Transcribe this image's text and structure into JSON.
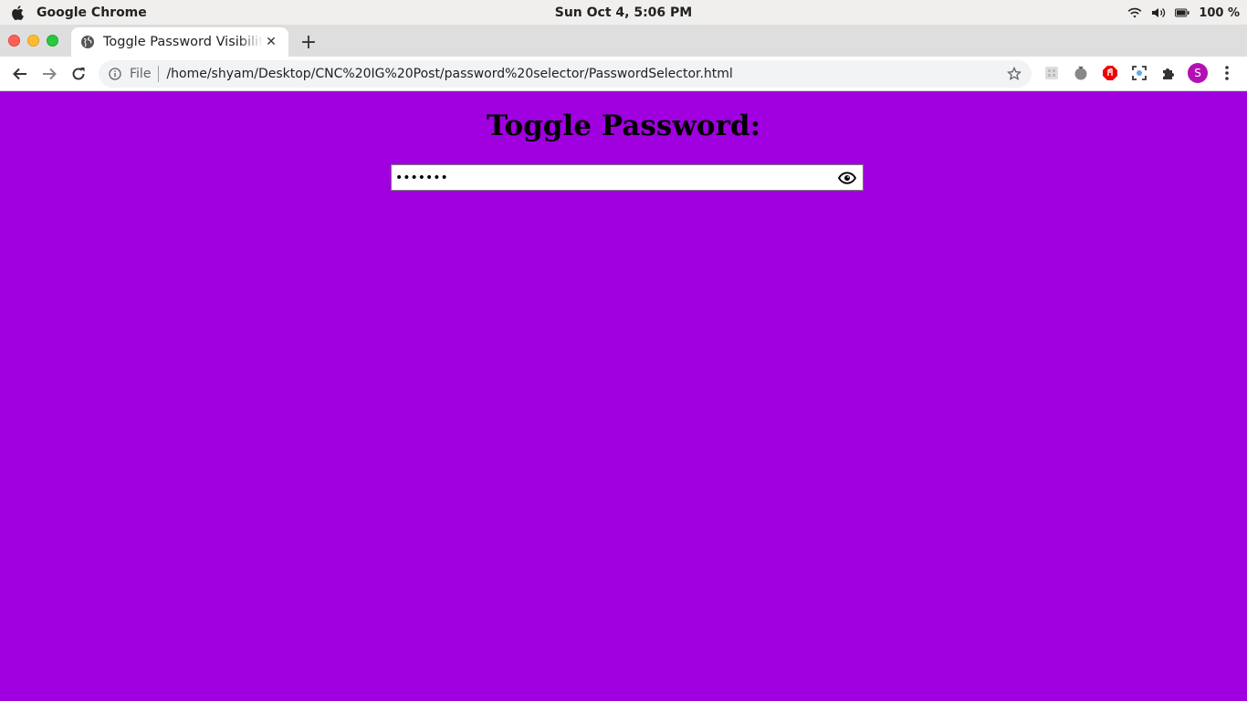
{
  "os": {
    "app_name": "Google Chrome",
    "clock": "Sun Oct  4,  5:06 PM",
    "battery": "100 %"
  },
  "browser": {
    "tab_title": "Toggle Password Visibility",
    "address_scheme": "File",
    "address_url": "/home/shyam/Desktop/CNC%20IG%20Post/password%20selector/PasswordSelector.html",
    "profile_initial": "S"
  },
  "page": {
    "heading": "Toggle Password:",
    "password_value": "•••••••",
    "background_color": "#a000e0"
  },
  "icons": {
    "apple": "apple-icon",
    "wifi": "wifi-icon",
    "volume": "volume-icon",
    "battery": "battery-icon",
    "globe": "globe-icon",
    "eye": "eye-icon"
  }
}
